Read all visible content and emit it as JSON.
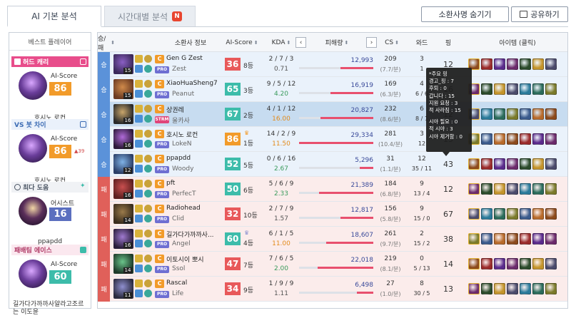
{
  "tabs": [
    {
      "label": "AI 기본 분석",
      "active": true
    },
    {
      "label": "시간대별 분석",
      "active": false,
      "badge": "N"
    }
  ],
  "buttons": {
    "hide_summoner": "소환사명 숨기기",
    "share": "공유하기"
  },
  "best_players": {
    "title": "베스트 플레이어",
    "cards": [
      {
        "title": "허드 캐리",
        "score_label": "AI-Score",
        "score": "86",
        "name": "호시노 로컨"
      },
      {
        "title": "VS 봇 차이",
        "score_label": "AI-Score",
        "score": "86",
        "rank_delta": "39",
        "name": "호시노 로컨"
      },
      {
        "title": "최다 도움",
        "score_label": "어시스트",
        "score": "16",
        "name": "ppapdd"
      },
      {
        "title": "패배팀 에이스",
        "score_label": "AI-Score",
        "score": "60",
        "name": "길가다가까까사알라고조르는 이도윤"
      }
    ]
  },
  "table": {
    "headers": {
      "result": "승/패",
      "summoner": "소환사 정보",
      "ai_score": "AI-Score",
      "kda": "KDA",
      "damage": "피해량",
      "cs": "CS",
      "ward": "와드",
      "ping": "핑",
      "items": "아이템 (클릭)"
    },
    "rows": [
      {
        "result": "승",
        "level": "15",
        "position": "C",
        "name": "Gen G Zest",
        "tag": "PRO",
        "handle": "Zest",
        "ai_score": "36",
        "rank": "8등",
        "kda": "2 / 7 / 3",
        "ratio": "0.71",
        "damage": "12,993",
        "damage_pct": 0.44,
        "cs": "209",
        "cs_per_min": "(7.7/분)",
        "ward": "3",
        "ward_sub": "1",
        "ping": "12"
      },
      {
        "result": "승",
        "level": "15",
        "position": "C",
        "name": "XiaoHuaSheng7",
        "tag": "PRO",
        "handle": "Peanut",
        "ai_score": "65",
        "rank": "3등",
        "kda": "9 / 5 / 12",
        "ratio": "4.20",
        "damage": "16,919",
        "damage_pct": 0.58,
        "cs": "169",
        "cs_per_min": "(6.3/분)",
        "ward": "4",
        "ward_sub": "6 / 6",
        "ping": "16"
      },
      {
        "result": "승",
        "level": "16",
        "position": "C",
        "name": "상권레",
        "tag": "STRM",
        "handle": "울카사",
        "ai_score": "67",
        "rank": "2등",
        "kda": "4 / 1 / 12",
        "ratio": "16.00",
        "damage": "20,827",
        "damage_pct": 0.71,
        "cs": "232",
        "cs_per_min": "(8.6/분)",
        "ward": "6",
        "ward_sub": "8 / 1",
        "ping": "12"
      },
      {
        "result": "승",
        "level": "16",
        "position": "C",
        "name": "호시노 로컨",
        "tag": "PRO",
        "handle": "LokeN",
        "ai_score": "86",
        "rank": "1등",
        "kda": "14 / 2 / 9",
        "ratio": "11.50",
        "damage": "29,334",
        "damage_pct": 1.0,
        "cs": "281",
        "cs_per_min": "(10.4/분)",
        "ward": "3",
        "ward_sub": "12",
        "ping": "15"
      },
      {
        "result": "승",
        "level": "12",
        "position": "C",
        "name": "ppapdd",
        "tag": "PRO",
        "handle": "Woody",
        "ai_score": "52",
        "rank": "5등",
        "kda": "0 / 6 / 16",
        "ratio": "2.67",
        "damage": "5,296",
        "damage_pct": 0.18,
        "cs": "31",
        "cs_per_min": "(1.1/분)",
        "ward": "12",
        "ward_sub": "35 / 11",
        "ping": "43"
      },
      {
        "result": "패",
        "level": "16",
        "position": "C",
        "name": "pft",
        "tag": "PRO",
        "handle": "PerfecT",
        "ai_score": "50",
        "rank": "6등",
        "kda": "5 / 6 / 9",
        "ratio": "2.33",
        "damage": "21,389",
        "damage_pct": 0.73,
        "cs": "184",
        "cs_per_min": "(6.8/분)",
        "ward": "9",
        "ward_sub": "13 / 4",
        "ping": "12"
      },
      {
        "result": "패",
        "level": "14",
        "position": "C",
        "name": "Radiohead",
        "tag": "PRO",
        "handle": "Clid",
        "ai_score": "32",
        "rank": "10등",
        "kda": "2 / 7 / 9",
        "ratio": "1.57",
        "damage": "12,817",
        "damage_pct": 0.44,
        "cs": "156",
        "cs_per_min": "(5.8/분)",
        "ward": "9",
        "ward_sub": "15 / 0",
        "ping": "67"
      },
      {
        "result": "패",
        "level": "16",
        "position": "C",
        "name": "길가다가까까사...",
        "tag": "PRO",
        "handle": "Angel",
        "ai_score": "60",
        "rank": "4등",
        "kda": "6 / 1 / 5",
        "ratio": "11.00",
        "damage": "18,607",
        "damage_pct": 0.63,
        "cs": "261",
        "cs_per_min": "(9.7/분)",
        "ward": "2",
        "ward_sub": "15 / 2",
        "ping": "38"
      },
      {
        "result": "패",
        "level": "14",
        "position": "C",
        "name": "이토시이 뽀시",
        "tag": "PRO",
        "handle": "Ssol",
        "ai_score": "47",
        "rank": "7등",
        "kda": "7 / 6 / 5",
        "ratio": "2.00",
        "damage": "22,018",
        "damage_pct": 0.75,
        "cs": "219",
        "cs_per_min": "(8.1/분)",
        "ward": "0",
        "ward_sub": "5 / 13",
        "ping": "14"
      },
      {
        "result": "패",
        "level": "11",
        "position": "C",
        "name": "Rascal",
        "tag": "PRO",
        "handle": "Life",
        "ai_score": "34",
        "rank": "9등",
        "kda": "1 / 9 / 9",
        "ratio": "1.11",
        "damage": "6,498",
        "damage_pct": 0.22,
        "cs": "27",
        "cs_per_min": "(1.0/분)",
        "ward": "8",
        "ward_sub": "30 / 5",
        "ping": "13"
      }
    ]
  },
  "tooltip": {
    "lines": [
      "*주요 핑",
      "경고_핑 : 7",
      "후퇴 : 0",
      "갑니다 : 15",
      "지원 요청 : 3",
      "적 사라짐 : 15"
    ],
    "lines2": [
      "시야 필요 : 0",
      "적 시야 : 3",
      "시야 제거함 : 0"
    ]
  },
  "colors": {
    "win_bg": "#eaf2fb",
    "lose_bg": "#fbeceb",
    "win_bar": "#5b92d9",
    "lose_bar": "#e0605a",
    "damage_bar": "#e8506e",
    "accent_orange": "#f29b2a",
    "accent_teal": "#3dbcaa",
    "accent_red": "#e8595a"
  },
  "icons": {
    "share": "share-icon",
    "sort": "sort-icon",
    "prev": "chevron-left-icon",
    "next": "chevron-right-icon",
    "crown": "crown-icon"
  }
}
